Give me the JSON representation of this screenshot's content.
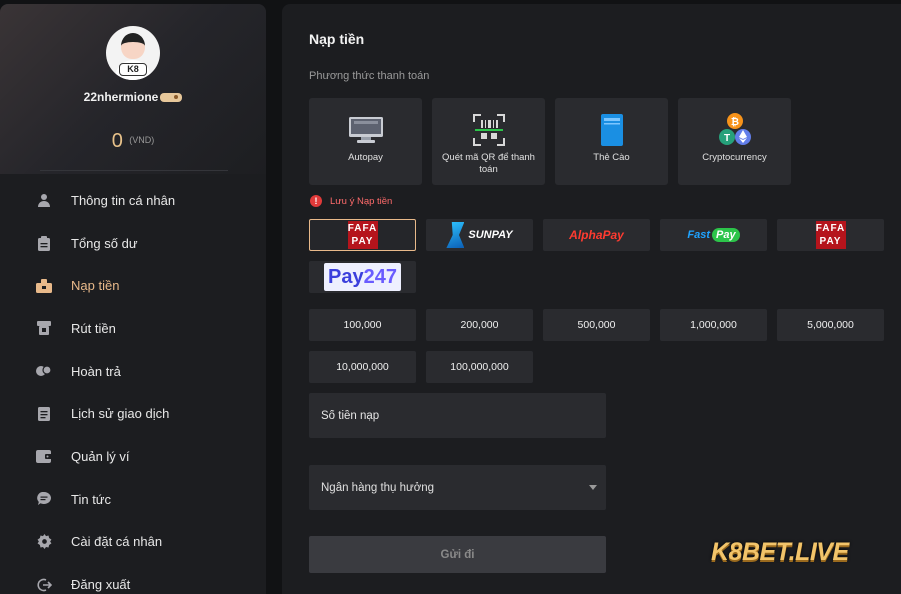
{
  "user": {
    "avatar_tag": "K8",
    "username": "22nhermione",
    "balance_amount": "0",
    "balance_currency": "(VND)"
  },
  "menu": [
    {
      "label": "Thông tin cá nhân",
      "icon": "user-icon"
    },
    {
      "label": "Tổng số dư",
      "icon": "clipboard-icon"
    },
    {
      "label": "Nạp tiền",
      "icon": "deposit-icon",
      "active": true
    },
    {
      "label": "Rút tiền",
      "icon": "withdraw-icon"
    },
    {
      "label": "Hoàn trả",
      "icon": "cashback-icon"
    },
    {
      "label": "Lịch sử giao dịch",
      "icon": "history-icon"
    },
    {
      "label": "Quản lý ví",
      "icon": "wallet-icon"
    },
    {
      "label": "Tin tức",
      "icon": "chat-icon"
    },
    {
      "label": "Cài đặt cá nhân",
      "icon": "settings-icon"
    },
    {
      "label": "Đăng xuất",
      "icon": "logout-icon"
    }
  ],
  "main": {
    "title": "Nạp tiền",
    "methods_title": "Phương thức thanh toán",
    "methods": [
      {
        "label": "Autopay",
        "icon": "monitor-icon"
      },
      {
        "label": "Quét mã QR để thanh toán",
        "icon": "qr-scan-icon"
      },
      {
        "label": "Thẻ Cào",
        "icon": "card-icon"
      },
      {
        "label": "Cryptocurrency",
        "icon": "crypto-icon"
      }
    ],
    "note": "Lưu ý Nạp tiền",
    "providers": {
      "fafa_line1": "FAFA",
      "fafa_line2": "PAY",
      "sunpay": "SUNPAY",
      "alphapay": "AlphaPay",
      "fastpay_fast": "Fast",
      "fastpay_pay": "Pay",
      "pay247_a": "Pay",
      "pay247_b": "247"
    },
    "amounts": [
      "100,000",
      "200,000",
      "500,000",
      "1,000,000",
      "5,000,000",
      "10,000,000",
      "100,000,000"
    ],
    "amount_placeholder": "Số tiền nạp",
    "bank_select_label": "Ngân hàng thụ hưởng",
    "submit_label": "Gửi đi"
  },
  "watermark": "K8BET.LIVE",
  "colors": {
    "accent": "#e8b98a",
    "background": "#111214",
    "panel": "#1c1d20",
    "card": "#2a2b2f",
    "warning": "#e03a3a"
  }
}
